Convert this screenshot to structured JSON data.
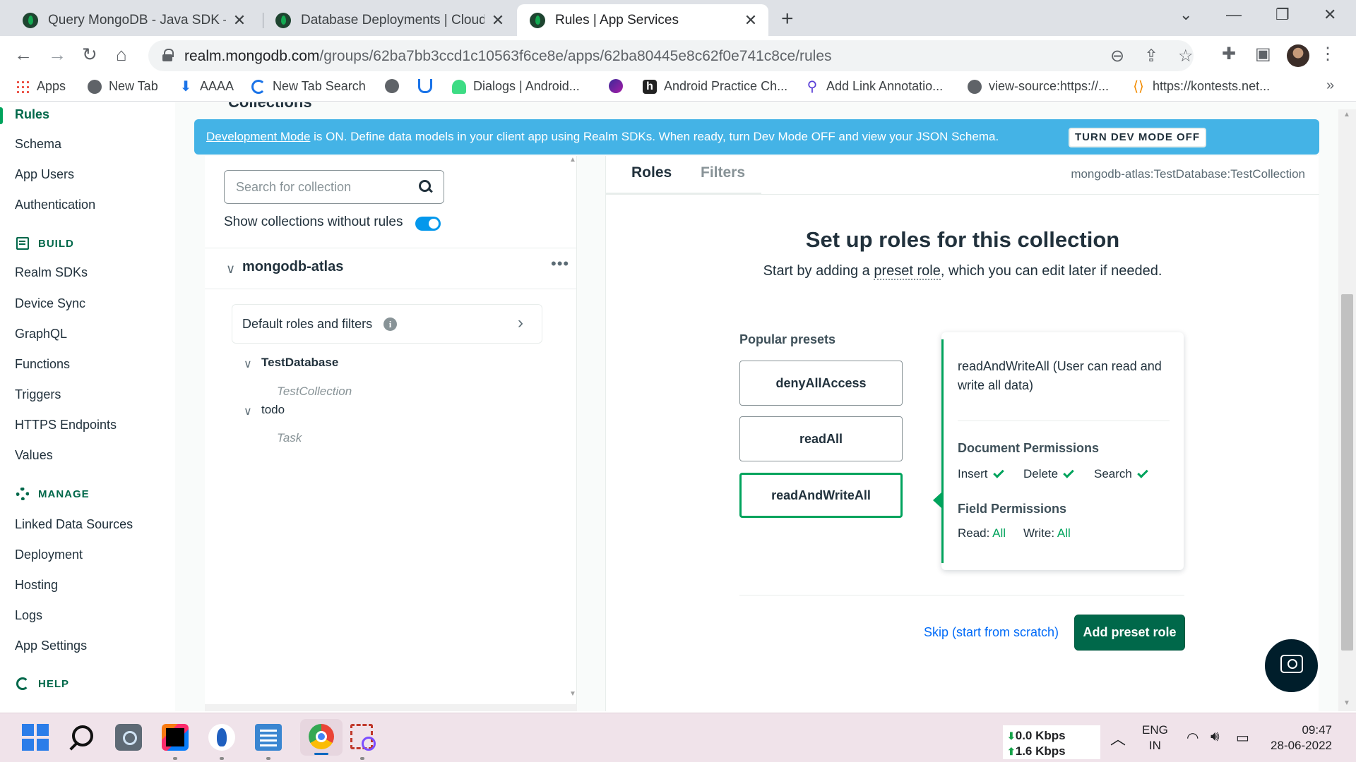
{
  "browser": {
    "tabs": [
      {
        "title": "Query MongoDB - Java SDK — R"
      },
      {
        "title": "Database Deployments | Cloud: M"
      },
      {
        "title": "Rules | App Services"
      }
    ],
    "new_tab_symbol": "+",
    "close_symbol": "✕",
    "url_host": "realm.mongodb.com",
    "url_path": "/groups/62ba7bb3ccd1c10563f6ce8e/apps/62ba80445e8c62f0e741c8ce/rules",
    "bookmarks": [
      {
        "label": "Apps",
        "icon": "apps-grid-icon"
      },
      {
        "label": "New Tab",
        "icon": "globe-icon"
      },
      {
        "label": "AAAA",
        "icon": "download-icon"
      },
      {
        "label": "New Tab Search",
        "icon": "swirl-icon"
      },
      {
        "label": "",
        "icon": "globe-icon"
      },
      {
        "label": "",
        "icon": "magnet-icon"
      },
      {
        "label": "Dialogs | Android...",
        "icon": "android-icon"
      },
      {
        "label": "",
        "icon": "bolt-icon"
      },
      {
        "label": "Android Practice Ch...",
        "icon": "h-icon"
      },
      {
        "label": "Add Link Annotatio...",
        "icon": "link-icon"
      },
      {
        "label": "view-source:https://...",
        "icon": "globe-icon"
      },
      {
        "label": "https://kontests.net...",
        "icon": "code-icon"
      }
    ],
    "bookmarks_more": "»"
  },
  "sidebar": {
    "items": [
      {
        "label": "Rules",
        "active": true
      },
      {
        "label": "Schema"
      },
      {
        "label": "App Users"
      },
      {
        "label": "Authentication"
      }
    ],
    "build": {
      "title": "BUILD",
      "items": [
        "Realm SDKs",
        "Device Sync",
        "GraphQL",
        "Functions",
        "Triggers",
        "HTTPS Endpoints",
        "Values"
      ]
    },
    "manage": {
      "title": "MANAGE",
      "items": [
        "Linked Data Sources",
        "Deployment",
        "Hosting",
        "Logs",
        "App Settings"
      ]
    },
    "help": {
      "title": "HELP"
    }
  },
  "banner": {
    "link": "Development Mode",
    "text": " is ON. Define data models in your client app using Realm SDKs. When ready, turn Dev Mode OFF and view your JSON Schema.",
    "button": "TURN DEV MODE OFF",
    "color": "#44b3e6"
  },
  "collections": {
    "heading": "Collections",
    "search_placeholder": "Search for collection",
    "show_without_rules": "Show collections without rules",
    "cluster": "mongodb-atlas",
    "more": "•••",
    "default_roles": "Default roles and filters",
    "tree": [
      {
        "db": "TestDatabase",
        "collections": [
          "TestCollection"
        ]
      },
      {
        "db": "todo",
        "collections": [
          "Task"
        ]
      }
    ]
  },
  "rules": {
    "tabs": [
      "Roles",
      "Filters"
    ],
    "path": "mongodb-atlas:TestDatabase:TestCollection",
    "title": "Set up roles for this collection",
    "subtitle_before": "Start by adding a ",
    "subtitle_link": "preset role",
    "subtitle_after": ", which you can edit later if needed.",
    "presets_label": "Popular presets",
    "presets": [
      "denyAllAccess",
      "readAll",
      "readAndWriteAll"
    ],
    "selected_preset": "readAndWriteAll",
    "card": {
      "description": "readAndWriteAll (User can read and write all data)",
      "doc_perm_title": "Document Permissions",
      "doc_perms": [
        "Insert",
        "Delete",
        "Search"
      ],
      "field_perm_title": "Field Permissions",
      "read_label": "Read:",
      "read_value": "All",
      "write_label": "Write:",
      "write_value": "All"
    },
    "skip": "Skip (start from scratch)",
    "add_button": "Add preset role",
    "accent": "#00a35c",
    "primary": "#00684a"
  },
  "taskbar": {
    "net_down": "0.0 Kbps",
    "net_up": "1.6 Kbps",
    "lang_1": "ENG",
    "lang_2": "IN",
    "time": "09:47",
    "date": "28-06-2022"
  }
}
